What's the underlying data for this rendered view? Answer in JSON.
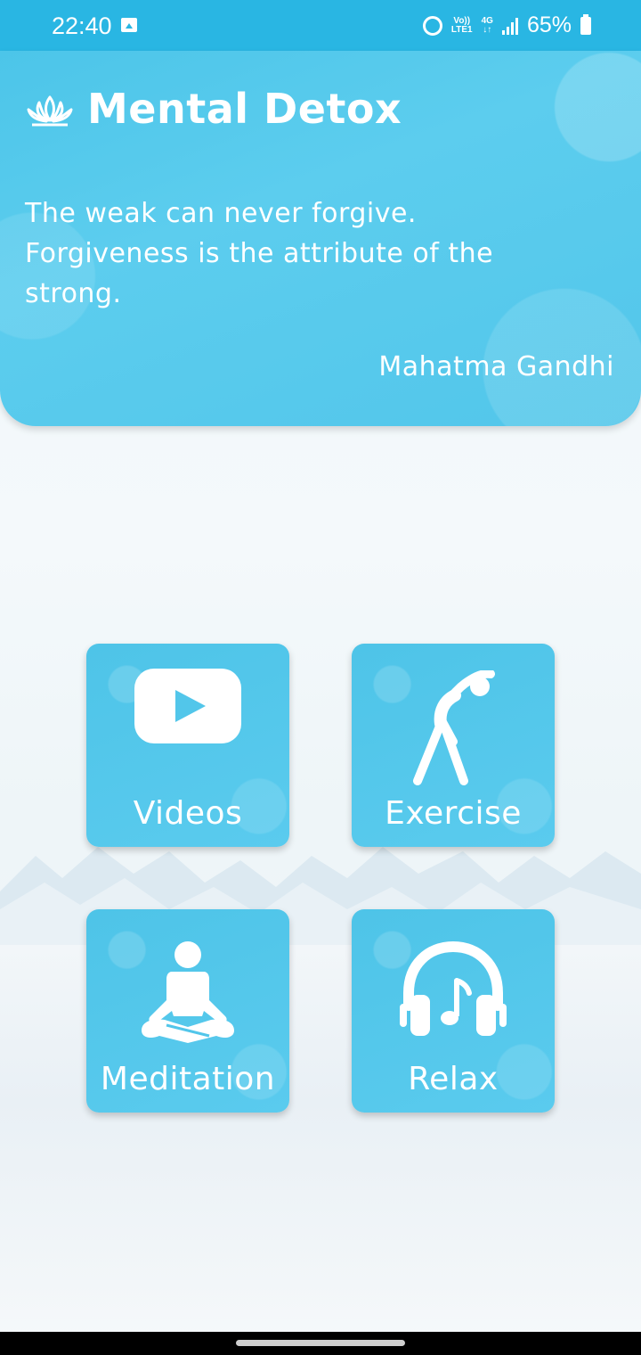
{
  "status_bar": {
    "time": "22:40",
    "network_top": "Vo))",
    "network_bottom": "LTE1",
    "data_top": "4G",
    "data_bottom": "↓↑",
    "battery": "65%",
    "icons": [
      "image-icon",
      "alarm-icon",
      "signal-icon",
      "battery-icon"
    ]
  },
  "header": {
    "app_title": "Mental Detox",
    "logo_icon": "lotus-icon",
    "quote": "The weak can never forgive. Forgiveness is the attribute of the strong.",
    "author": "Mahatma Gandhi"
  },
  "tiles": [
    {
      "label": "Videos",
      "icon": "play-video-icon"
    },
    {
      "label": "Exercise",
      "icon": "exercise-icon"
    },
    {
      "label": "Meditation",
      "icon": "meditation-icon"
    },
    {
      "label": "Relax",
      "icon": "headphones-icon"
    }
  ],
  "colors": {
    "accent": "#29b6e3",
    "tile": "#52c6ea",
    "text": "#ffffff"
  }
}
